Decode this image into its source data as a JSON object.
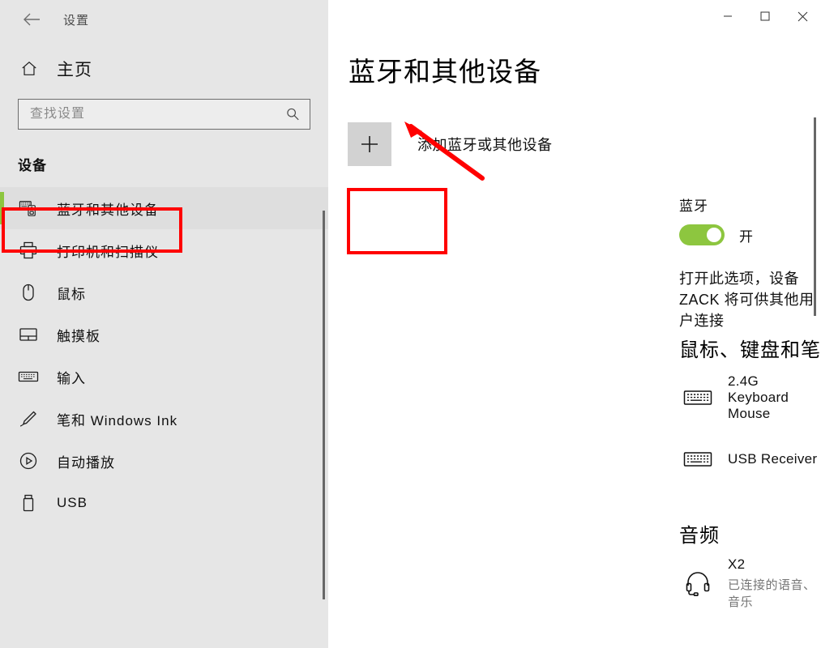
{
  "window": {
    "app_title": "设置",
    "back_icon": "back-arrow-icon",
    "controls": {
      "minimize": "minimize-icon",
      "maximize": "maximize-icon",
      "close": "close-icon"
    }
  },
  "sidebar": {
    "home_label": "主页",
    "home_icon": "home-icon",
    "search": {
      "placeholder": "查找设置",
      "value": "",
      "icon": "search-icon"
    },
    "section_title": "设备",
    "items": [
      {
        "label": "蓝牙和其他设备",
        "icon": "bluetooth-devices-icon",
        "selected": true
      },
      {
        "label": "打印机和扫描仪",
        "icon": "printer-icon",
        "selected": false
      },
      {
        "label": "鼠标",
        "icon": "mouse-icon",
        "selected": false
      },
      {
        "label": "触摸板",
        "icon": "touchpad-icon",
        "selected": false
      },
      {
        "label": "输入",
        "icon": "keyboard-icon",
        "selected": false
      },
      {
        "label": "笔和 Windows Ink",
        "icon": "pen-icon",
        "selected": false
      },
      {
        "label": "自动播放",
        "icon": "autoplay-icon",
        "selected": false
      },
      {
        "label": "USB",
        "icon": "usb-icon",
        "selected": false
      }
    ]
  },
  "main": {
    "page_title": "蓝牙和其他设备",
    "add_device": {
      "label": "添加蓝牙或其他设备",
      "icon": "plus-icon"
    },
    "bluetooth": {
      "title": "蓝牙",
      "toggle_state_label": "开",
      "toggle_on": true,
      "toggle_color": "#8DC63F",
      "description": "打开此选项，设备 ZACK 将可供其他用户连接"
    },
    "groups": [
      {
        "title": "鼠标、键盘和笔",
        "devices": [
          {
            "name": "2.4G Keyboard Mouse",
            "status": "",
            "icon": "keyboard-icon"
          },
          {
            "name": "USB Receiver",
            "status": "",
            "icon": "keyboard-icon"
          }
        ]
      },
      {
        "title": "音频",
        "devices": [
          {
            "name": "X2",
            "status": "已连接的语音、音乐",
            "icon": "headset-icon"
          }
        ]
      }
    ]
  },
  "annotations": {
    "highlight_color": "#FF0000",
    "boxes": [
      {
        "name": "sidebar-bluetooth-highlight"
      },
      {
        "name": "bluetooth-toggle-highlight"
      }
    ],
    "arrow": {
      "name": "pointer-arrow",
      "points_to": "添加蓝牙或其他设备"
    }
  }
}
